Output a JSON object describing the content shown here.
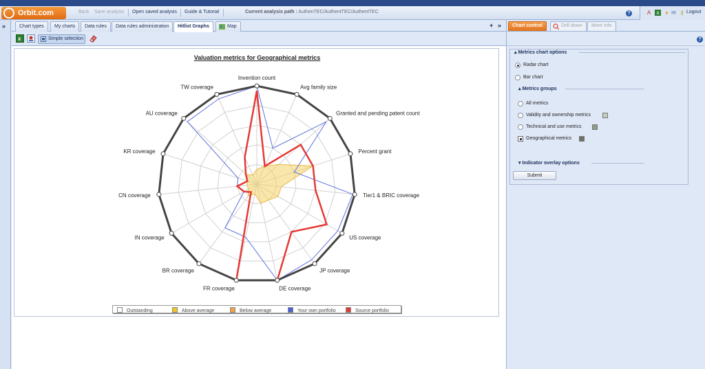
{
  "header": {
    "logo": "Orbit.com",
    "back": "Back",
    "save_analysis": "Save analysis",
    "open_saved": "Open saved analysis",
    "guide": "Guide & Tutorial",
    "path_label": "Current analysis path :",
    "path_value": "AuthenTEC/AuthentTEC/AuthentTEC",
    "logout": "Logout"
  },
  "tabs": {
    "items": [
      {
        "label": "Chart types"
      },
      {
        "label": "My charts"
      },
      {
        "label": "Data rules"
      },
      {
        "label": "Data rules administration"
      },
      {
        "label": "Hitlist Graphs"
      },
      {
        "label": "Map"
      }
    ],
    "add": "+",
    "expand": "»"
  },
  "toolbar": {
    "simple_selection": "Simple selection"
  },
  "chart_data": {
    "type": "radar",
    "title": "Valuation metrics for Geographical metrics",
    "axes": [
      "Invention count",
      "Avg family size",
      "Granted and pending patent count",
      "Percent grant",
      "Tier1 & BRIC coverage",
      "US coverage",
      "JP coverage",
      "DE coverage",
      "FR coverage",
      "BR coverage",
      "IN coverage",
      "CN coverage",
      "KR coverage",
      "AU coverage",
      "TW coverage"
    ],
    "rmax": 1,
    "rings": 5,
    "series": [
      {
        "name": "Outstanding",
        "color": "#444444",
        "values": [
          1,
          1,
          1,
          1,
          1,
          1,
          1,
          1,
          1,
          1,
          1,
          1,
          1,
          1,
          1
        ]
      },
      {
        "name": "Your own portfolio",
        "color": "#5b6ee0",
        "values": [
          1,
          0.4,
          0.95,
          0.4,
          0.98,
          0.95,
          0.95,
          1,
          0.55,
          0.55,
          0.15,
          0.2,
          0.2,
          0.95,
          0.95
        ]
      },
      {
        "name": "Source portfolio",
        "color": "#e53935",
        "values": [
          0.95,
          0.2,
          0.6,
          0.6,
          0.6,
          0.82,
          0.6,
          1,
          1,
          0.1,
          0.15,
          0.2,
          0.1,
          0.15,
          0.3
        ]
      },
      {
        "name": "Above average",
        "color": "#f4d166",
        "values": [
          0.15,
          0.2,
          0.3,
          0.6,
          0.25,
          0.25,
          0.2,
          0.2,
          0.1,
          0.15,
          0.1,
          0.1,
          0.1,
          0.15,
          0.1
        ]
      }
    ],
    "legend": [
      {
        "label": "Outstanding",
        "color": "#ffffff"
      },
      {
        "label": "Above average",
        "color": "#f3c419"
      },
      {
        "label": "Below average",
        "color": "#f3a048"
      },
      {
        "label": "Your own portfolio",
        "color": "#4b5fd8"
      },
      {
        "label": "Source portfolio",
        "color": "#e53935"
      }
    ]
  },
  "right_panel": {
    "tab_chart_control": "Chart control",
    "tab_drill_down": "Drill down",
    "tab_more_info": "More Info",
    "metrics_chart_options": "Metrics chart options",
    "radar_chart": "Radar chart",
    "bar_chart": "Bar chart",
    "metrics_groups": "Metrics groups",
    "groups": [
      {
        "label": "All metrics"
      },
      {
        "label": "Validity and ownership metrics"
      },
      {
        "label": "Technical and use metrics"
      },
      {
        "label": "Geographical metrics"
      }
    ],
    "indicator_overlay": "Indicator overlay options",
    "submit": "Submit"
  }
}
